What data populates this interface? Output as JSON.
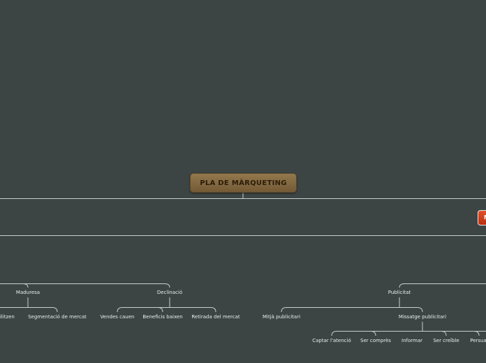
{
  "root": {
    "label": "PLA DE MÀRQUETING"
  },
  "side_node": {
    "label": "M"
  },
  "nodes": {
    "maduresa": "Maduresa",
    "declinacio": "Declinació",
    "estabilitzen": "abilitzen",
    "segmentacio": "Segmentació de mercat",
    "vendes_cauen": "Vendes cauen",
    "beneficis_baixen": "Beneficis baixen",
    "retirada": "Retirada del mercat",
    "publicitat": "Publicitat",
    "mitja": "Mitjà publicitari",
    "missatge": "Missatge publicitari",
    "captar": "Captar l'atenció",
    "compres": "Ser comprès",
    "informar": "Informar",
    "creible": "Ser creïble",
    "persuadir": "Persua"
  },
  "colors": {
    "background": "#3d4444",
    "line": "#c9cfcf",
    "root_fill": "#86693f",
    "root_text": "#2b1c08",
    "side_node_fill": "#d0401c",
    "node_text": "#e9eded"
  }
}
